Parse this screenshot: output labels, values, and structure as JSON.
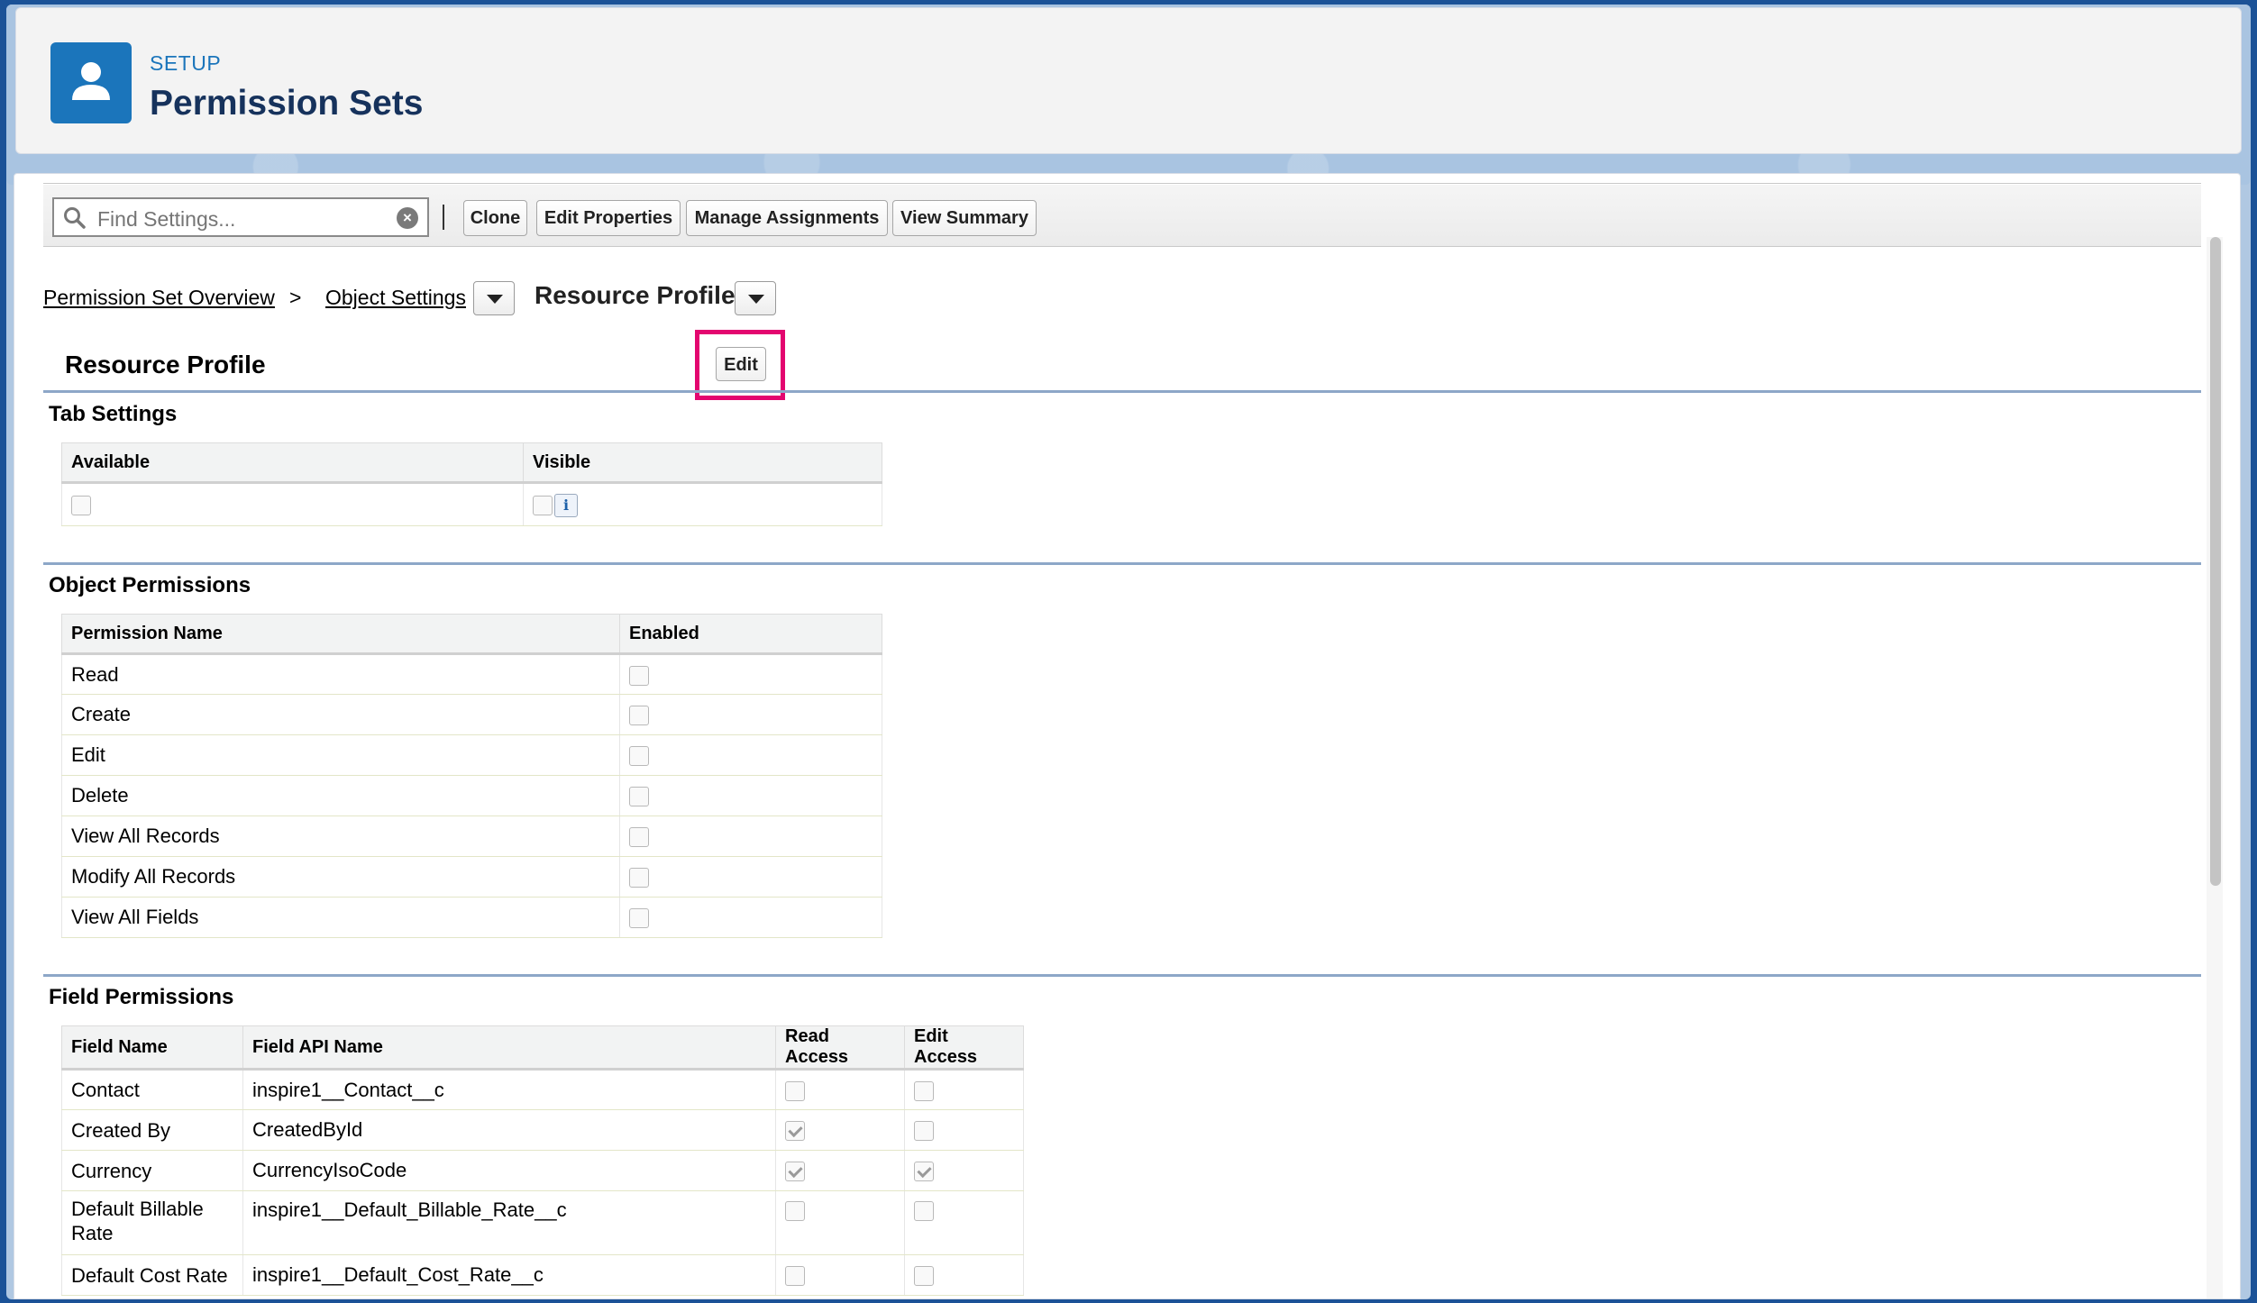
{
  "header": {
    "eyebrow": "SETUP",
    "title": "Permission Sets",
    "icon": "user-icon"
  },
  "toolbar": {
    "search_placeholder": "Find Settings...",
    "buttons": {
      "clone": "Clone",
      "edit_properties": "Edit Properties",
      "manage_assignments": "Manage Assignments",
      "view_summary": "View Summary"
    }
  },
  "breadcrumb": {
    "overview": "Permission Set Overview",
    "separator": ">",
    "object_settings": "Object Settings",
    "current": "Resource Profile"
  },
  "section": {
    "title": "Resource Profile",
    "edit_label": "Edit",
    "highlight_color": "#e3066f"
  },
  "tab_settings": {
    "title": "Tab Settings",
    "columns": [
      "Available",
      "Visible"
    ],
    "available_checked": false,
    "visible_checked": false,
    "info_label": "i"
  },
  "object_permissions": {
    "title": "Object Permissions",
    "columns": [
      "Permission Name",
      "Enabled"
    ],
    "rows": [
      {
        "name": "Read",
        "enabled": false
      },
      {
        "name": "Create",
        "enabled": false
      },
      {
        "name": "Edit",
        "enabled": false
      },
      {
        "name": "Delete",
        "enabled": false
      },
      {
        "name": "View All Records",
        "enabled": false
      },
      {
        "name": "Modify All Records",
        "enabled": false
      },
      {
        "name": "View All Fields",
        "enabled": false
      }
    ]
  },
  "field_permissions": {
    "title": "Field Permissions",
    "columns": [
      "Field Name",
      "Field API Name",
      "Read Access",
      "Edit Access"
    ],
    "rows": [
      {
        "field": "Contact",
        "api": "inspire1__Contact__c",
        "read": false,
        "edit": false
      },
      {
        "field": "Created By",
        "api": "CreatedById",
        "read": true,
        "edit": false
      },
      {
        "field": "Currency",
        "api": "CurrencyIsoCode",
        "read": true,
        "edit": true
      },
      {
        "field": "Default Billable Rate",
        "api": "inspire1__Default_Billable_Rate__c",
        "read": false,
        "edit": false
      },
      {
        "field": "Default Cost Rate",
        "api": "inspire1__Default_Cost_Rate__c",
        "read": false,
        "edit": false
      }
    ]
  }
}
